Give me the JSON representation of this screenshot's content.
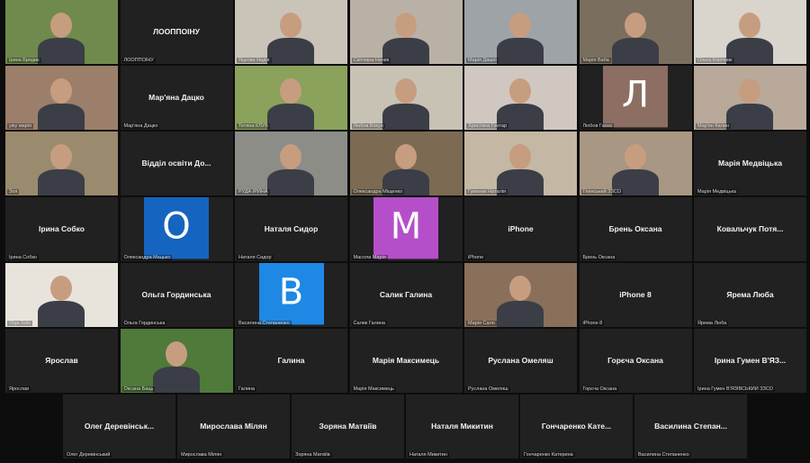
{
  "colors": {
    "background": "#0d0d0d",
    "tile": "#212121",
    "avatar_o": "#1565c0",
    "avatar_m": "#b54fc9",
    "avatar_v": "#1e88e5",
    "avatar_l": "#8d6e63"
  },
  "tiles": [
    {
      "kind": "video",
      "label": "Ірина Бредик",
      "bg": "#6f8a4c"
    },
    {
      "kind": "name",
      "name": "ЛООППОІНУ",
      "label": "ЛООППОІНУ"
    },
    {
      "kind": "video",
      "label": "Яцкова Надія",
      "bg": "#c9c3b8"
    },
    {
      "kind": "video",
      "label": "Світлана Начик",
      "bg": "#b9b1a6"
    },
    {
      "kind": "video",
      "label": "Марія Дацко",
      "bg": "#9ea3a8"
    },
    {
      "kind": "video",
      "label": "Марія Ваба",
      "bg": "#7a6e5e"
    },
    {
      "kind": "video",
      "label": "Ольга Ключник",
      "bg": "#d9d4cc"
    },
    {
      "kind": "video",
      "label": "ужу марія",
      "bg": "#9c7f6a"
    },
    {
      "kind": "name",
      "name": "Мар'яна Дацко",
      "label": "Мар'яна Дацко"
    },
    {
      "kind": "video",
      "label": "Тетяна КЛУБ",
      "bg": "#8aa25c"
    },
    {
      "kind": "video",
      "label": "Любов Бокун",
      "bg": "#c8c2b5"
    },
    {
      "kind": "video",
      "label": "Христина Гонтар",
      "bg": "#d0c7c0"
    },
    {
      "kind": "avatar",
      "letter": "Л",
      "color_key": "avatar_l",
      "label": "Любов Гаска"
    },
    {
      "kind": "video",
      "label": "Мар'ян Калин",
      "bg": "#b8a99a"
    },
    {
      "kind": "video",
      "label": "Зоя",
      "bg": "#9a8b6e"
    },
    {
      "kind": "name",
      "name": "Відділ освіти До...",
      "label": ""
    },
    {
      "kind": "video",
      "label": "РУДА ІРИНА",
      "bg": "#8d8d88"
    },
    {
      "kind": "video",
      "label": "Олександра Міщенко",
      "bg": "#7c6a52"
    },
    {
      "kind": "video",
      "label": "Гуменик Наталія",
      "bg": "#c4b7a3"
    },
    {
      "kind": "video",
      "label": "Глинський ЗЗСО",
      "bg": "#a89782"
    },
    {
      "kind": "name",
      "name": "Марія Медвіцька",
      "label": "Марія Медвіцька"
    },
    {
      "kind": "name",
      "name": "Ірина Собко",
      "label": "Ірина Собко"
    },
    {
      "kind": "avatar",
      "letter": "O",
      "color_key": "avatar_o",
      "label": "Олександра Мацько"
    },
    {
      "kind": "name",
      "name": "Наталя Сидор",
      "label": "Наталя Сидор"
    },
    {
      "kind": "avatar",
      "letter": "M",
      "color_key": "avatar_m",
      "label": "Масола Марія"
    },
    {
      "kind": "name",
      "name": "iPhone",
      "label": "iPhone"
    },
    {
      "kind": "name",
      "name": "Брень Оксана",
      "label": "Брень Оксана"
    },
    {
      "kind": "name",
      "name": "Ковальчук Потя...",
      "label": ""
    },
    {
      "kind": "video",
      "label": "Olga Solo",
      "bg": "#e8e4dc"
    },
    {
      "kind": "name",
      "name": "Ольга Гординська",
      "label": "Ольга Гординська"
    },
    {
      "kind": "avatar",
      "letter": "B",
      "color_key": "avatar_v",
      "label": "Василина Степаненко"
    },
    {
      "kind": "name",
      "name": "Салик Галина",
      "label": "Салик Галина"
    },
    {
      "kind": "video",
      "label": "Марія Сало",
      "bg": "#8a6f5a"
    },
    {
      "kind": "name",
      "name": "iPhone 8",
      "label": "iPhone 8"
    },
    {
      "kind": "name",
      "name": "Ярема Люба",
      "label": "Ярема Люба"
    },
    {
      "kind": "name",
      "name": "Ярослав",
      "label": "Ярослав"
    },
    {
      "kind": "video",
      "label": "Оксана Баць",
      "bg": "#4f7a3a"
    },
    {
      "kind": "name",
      "name": "Галина",
      "label": "Галина"
    },
    {
      "kind": "name",
      "name": "Марія Максимець",
      "label": "Марія Максимець"
    },
    {
      "kind": "name",
      "name": "Руслана Омеляш",
      "label": "Руслана Омеляш"
    },
    {
      "kind": "name",
      "name": "Горєча Оксана",
      "label": "Горєча Оксана"
    },
    {
      "kind": "name",
      "name": "Ірина Гумен В'ЯЗ...",
      "label": "Ірина Гумен В'ЯЗІВСЬКИЙ ЗЗСО"
    }
  ],
  "last_row": [
    {
      "name": "Олег Деревінськ...",
      "label": "Олег Деревінський"
    },
    {
      "name": "Мирослава Мілян",
      "label": "Мирослава Мілян"
    },
    {
      "name": "Зоряна Матвіїв",
      "label": "Зоряна Матвіїв"
    },
    {
      "name": "Наталя Микитин",
      "label": "Наталя Микитин"
    },
    {
      "name": "Гончаренко Кате...",
      "label": "Гончаренко Катерина"
    },
    {
      "name": "Василина Степан...",
      "label": "Василина Степаненко"
    }
  ]
}
